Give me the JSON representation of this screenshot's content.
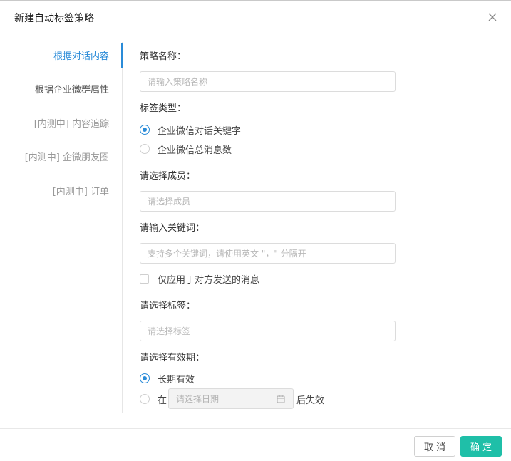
{
  "dialog": {
    "title": "新建自动标签策略",
    "close_icon": "close-icon"
  },
  "sidebar": {
    "items": [
      {
        "label": "根据对话内容",
        "state": "active"
      },
      {
        "label": "根据企业微群属性",
        "state": "normal"
      },
      {
        "label": "[内测中] 内容追踪",
        "state": "disabled"
      },
      {
        "label": "[内测中] 企微朋友圈",
        "state": "disabled"
      },
      {
        "label": "[内测中] 订单",
        "state": "disabled"
      }
    ]
  },
  "form": {
    "strategy_name": {
      "label": "策略名称：",
      "value": "",
      "placeholder": "请输入策略名称"
    },
    "tag_type": {
      "label": "标签类型：",
      "options": [
        {
          "label": "企业微信对话关键字",
          "checked": true
        },
        {
          "label": "企业微信总消息数",
          "checked": false
        }
      ]
    },
    "members": {
      "label": "请选择成员：",
      "value": "",
      "placeholder": "请选择成员"
    },
    "keywords": {
      "label": "请输入关键词：",
      "value": "",
      "placeholder": "支持多个关键词，请使用英文 \"，\" 分隔开"
    },
    "only_other_party": {
      "label": "仅应用于对方发送的消息",
      "checked": false
    },
    "tags": {
      "label": "请选择标签：",
      "value": "",
      "placeholder": "请选择标签"
    },
    "validity": {
      "label": "请选择有效期：",
      "options": [
        {
          "label": "长期有效",
          "checked": true
        },
        {
          "label": "在",
          "checked": false
        }
      ],
      "date_placeholder": "请选择日期",
      "date_suffix": "后失效",
      "calendar_icon": "calendar-icon"
    }
  },
  "footer": {
    "cancel_label": "取 消",
    "ok_label": "确 定"
  },
  "colors": {
    "accent": "#2a8bd8",
    "primary_button": "#1fbfa8",
    "border": "#dcdcdc"
  }
}
